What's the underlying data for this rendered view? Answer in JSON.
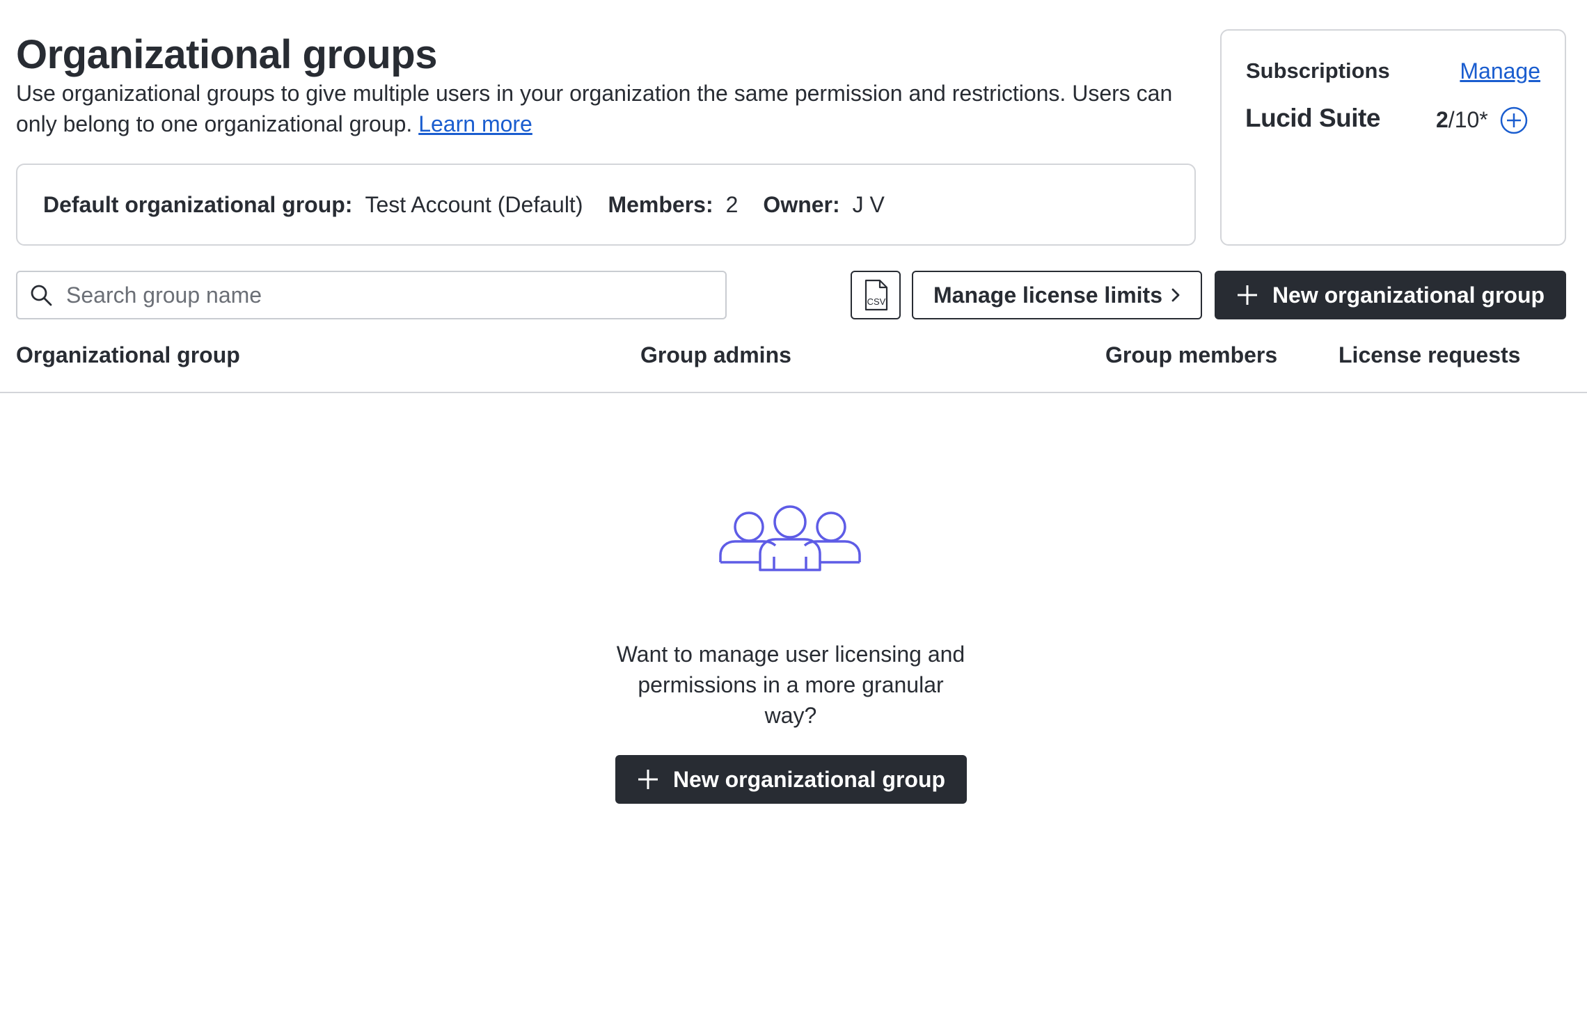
{
  "header": {
    "title": "Organizational groups",
    "description": "Use organizational groups to give multiple users in your organization the same permission and restrictions. Users can only belong to one organizational group.",
    "learn_more": "Learn more"
  },
  "default_group": {
    "group_label": "Default organizational group:",
    "group_value": "Test Account (Default)",
    "members_label": "Members:",
    "members_value": "2",
    "owner_label": "Owner:",
    "owner_value": "J V"
  },
  "subscriptions": {
    "title": "Subscriptions",
    "manage_label": "Manage",
    "product": "Lucid Suite",
    "used": "2",
    "limit": "/10*",
    "add_icon": "plus-circle-icon"
  },
  "toolbar": {
    "search_placeholder": "Search group name",
    "search_value": "",
    "csv_icon": "csv-file-icon",
    "manage_license_label": "Manage license limits",
    "new_group_label": "New organizational group"
  },
  "table": {
    "columns": [
      "Organizational group",
      "Group admins",
      "Group members",
      "License requests"
    ],
    "rows": []
  },
  "empty_state": {
    "illustration": "people-group-icon",
    "message": "Want to manage user licensing and permissions in a more granular way?",
    "button_label": "New organizational group"
  },
  "colors": {
    "text": "#282c33",
    "link": "#1a5dcf",
    "primary_button": "#282c33",
    "border": "#d3d5d9",
    "illustration": "#5e5ce6"
  }
}
